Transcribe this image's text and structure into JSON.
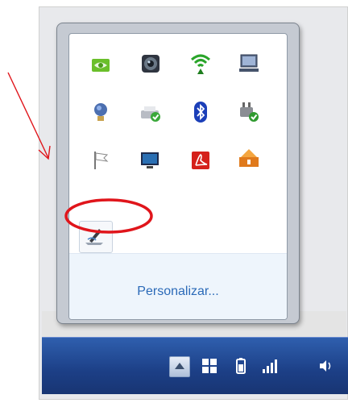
{
  "tray_popup": {
    "customize_link": "Personalizar...",
    "icons": [
      {
        "name": "nvidia-icon"
      },
      {
        "name": "webcam-icon"
      },
      {
        "name": "wifi-icon"
      },
      {
        "name": "laptop-display-icon"
      },
      {
        "name": "lightbulb-icon"
      },
      {
        "name": "printer-check-icon"
      },
      {
        "name": "bluetooth-icon"
      },
      {
        "name": "power-plug-icon"
      },
      {
        "name": "action-center-flag-icon"
      },
      {
        "name": "network-monitor-icon"
      },
      {
        "name": "acrobat-icon"
      },
      {
        "name": "update-icon"
      },
      {
        "name": "pen-tablet-icon"
      }
    ]
  },
  "taskbar": {
    "items": [
      "show-hidden-icons-button",
      "windows-icon",
      "battery-icon",
      "signal-icon",
      "volume-icon"
    ]
  },
  "colors": {
    "taskbar": "#1c3f86",
    "link": "#2b6ab8",
    "annotation": "#e0151b"
  }
}
